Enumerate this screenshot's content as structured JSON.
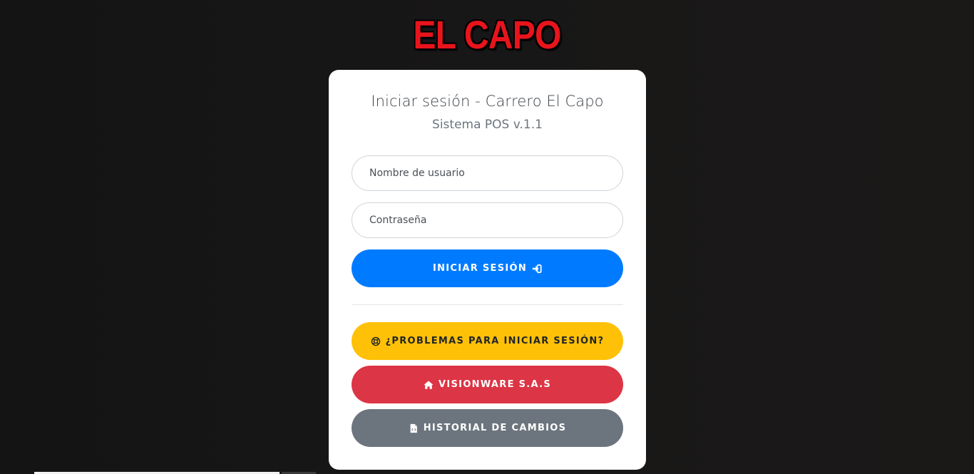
{
  "brand": {
    "logo_text": "EL CAPO"
  },
  "login": {
    "title": "Iniciar sesión - Carrero El Capo",
    "subtitle": "Sistema POS v.1.1",
    "username_placeholder": "Nombre de usuario",
    "password_placeholder": "Contraseña",
    "submit_label": "INICIAR SESIÓN",
    "submit_icon": "sign-in-icon"
  },
  "links": {
    "help_label": "¿PROBLEMAS PARA INICIAR SESIÓN?",
    "help_icon": "life-ring-icon",
    "vision_label": "VISIONWARE S.A.S",
    "vision_icon": "home-icon",
    "history_label": "HISTORIAL DE CAMBIOS",
    "history_icon": "file-code-icon"
  },
  "colors": {
    "logo": "#e8141c",
    "primary": "#007bff",
    "warning": "#ffc107",
    "danger": "#dc3545",
    "secondary": "#6c757d",
    "background": "#161515"
  }
}
